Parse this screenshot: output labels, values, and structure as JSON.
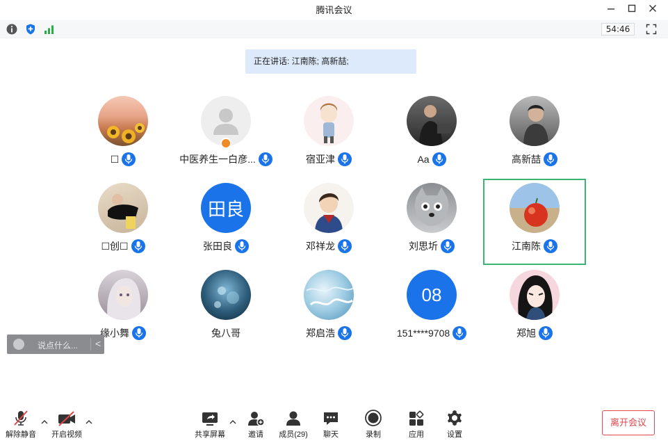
{
  "window": {
    "title": "腾讯会议"
  },
  "info_bar": {
    "info_icon": "info-icon",
    "security_icon": "shield-icon",
    "signal_icon": "signal-icon",
    "timer": "54:46"
  },
  "speaking_banner": {
    "text": "正在讲话: 江南陈; 高新喆;"
  },
  "participants": [
    {
      "name": "☐",
      "avatar": "sunflower-photo"
    },
    {
      "name": "中医养生一白彦...",
      "avatar": "default-person"
    },
    {
      "name": "宿亚津",
      "avatar": "cartoon-girl"
    },
    {
      "name": "Aa",
      "avatar": "man-photo"
    },
    {
      "name": "高新喆",
      "avatar": "man-photo"
    },
    {
      "name": "☐创☐",
      "avatar": "person-photo"
    },
    {
      "name": "张田良",
      "avatar_text": "田良"
    },
    {
      "name": "邓祥龙",
      "avatar": "cartoon-boy"
    },
    {
      "name": "刘思圻",
      "avatar": "cat-photo"
    },
    {
      "name": "江南陈",
      "avatar": "fruit-photo"
    },
    {
      "name": "缘小舞",
      "avatar": "girl-photo"
    },
    {
      "name": "兔八哥",
      "avatar": "underwater-photo"
    },
    {
      "name": "郑启浩",
      "avatar": "water-photo"
    },
    {
      "name": "151****9708",
      "avatar_text": "08"
    },
    {
      "name": "郑旭",
      "avatar": "anime-portrait"
    }
  ],
  "chat": {
    "placeholder": "说点什么...",
    "collapse": "<"
  },
  "toolbar": {
    "unmute": "解除静音",
    "video": "开启视频",
    "share": "共享屏幕",
    "invite": "邀请",
    "members": "成员(29)",
    "chat": "聊天",
    "record": "录制",
    "apps": "应用",
    "settings": "设置",
    "leave": "离开会议"
  },
  "colors": {
    "accent": "#1a73e8",
    "active_border": "#3cb371",
    "leave": "#e0484c",
    "banner": "#ddeafb"
  }
}
